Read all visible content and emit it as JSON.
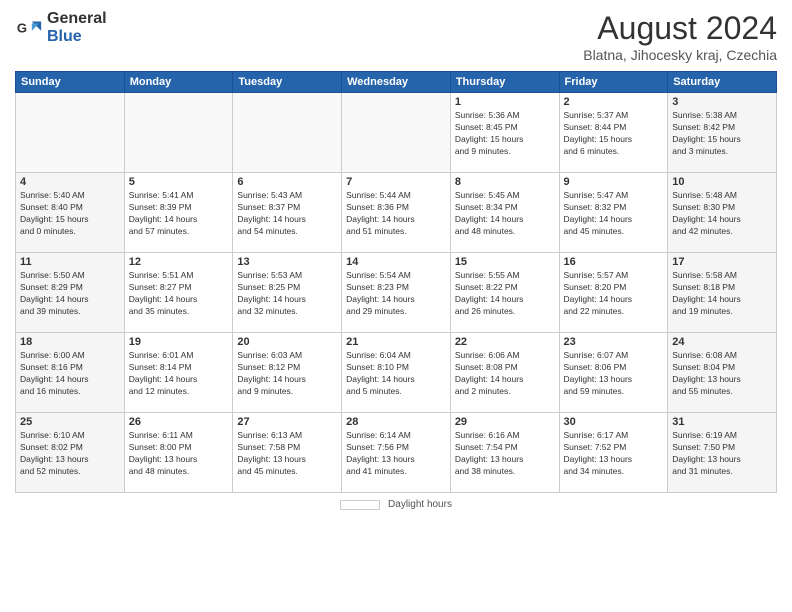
{
  "header": {
    "logo_general": "General",
    "logo_blue": "Blue",
    "main_title": "August 2024",
    "subtitle": "Blatna, Jihocesky kraj, Czechia"
  },
  "calendar": {
    "days_of_week": [
      "Sunday",
      "Monday",
      "Tuesday",
      "Wednesday",
      "Thursday",
      "Friday",
      "Saturday"
    ],
    "weeks": [
      [
        {
          "day": "",
          "info": ""
        },
        {
          "day": "",
          "info": ""
        },
        {
          "day": "",
          "info": ""
        },
        {
          "day": "",
          "info": ""
        },
        {
          "day": "1",
          "info": "Sunrise: 5:36 AM\nSunset: 8:45 PM\nDaylight: 15 hours\nand 9 minutes."
        },
        {
          "day": "2",
          "info": "Sunrise: 5:37 AM\nSunset: 8:44 PM\nDaylight: 15 hours\nand 6 minutes."
        },
        {
          "day": "3",
          "info": "Sunrise: 5:38 AM\nSunset: 8:42 PM\nDaylight: 15 hours\nand 3 minutes."
        }
      ],
      [
        {
          "day": "4",
          "info": "Sunrise: 5:40 AM\nSunset: 8:40 PM\nDaylight: 15 hours\nand 0 minutes."
        },
        {
          "day": "5",
          "info": "Sunrise: 5:41 AM\nSunset: 8:39 PM\nDaylight: 14 hours\nand 57 minutes."
        },
        {
          "day": "6",
          "info": "Sunrise: 5:43 AM\nSunset: 8:37 PM\nDaylight: 14 hours\nand 54 minutes."
        },
        {
          "day": "7",
          "info": "Sunrise: 5:44 AM\nSunset: 8:36 PM\nDaylight: 14 hours\nand 51 minutes."
        },
        {
          "day": "8",
          "info": "Sunrise: 5:45 AM\nSunset: 8:34 PM\nDaylight: 14 hours\nand 48 minutes."
        },
        {
          "day": "9",
          "info": "Sunrise: 5:47 AM\nSunset: 8:32 PM\nDaylight: 14 hours\nand 45 minutes."
        },
        {
          "day": "10",
          "info": "Sunrise: 5:48 AM\nSunset: 8:30 PM\nDaylight: 14 hours\nand 42 minutes."
        }
      ],
      [
        {
          "day": "11",
          "info": "Sunrise: 5:50 AM\nSunset: 8:29 PM\nDaylight: 14 hours\nand 39 minutes."
        },
        {
          "day": "12",
          "info": "Sunrise: 5:51 AM\nSunset: 8:27 PM\nDaylight: 14 hours\nand 35 minutes."
        },
        {
          "day": "13",
          "info": "Sunrise: 5:53 AM\nSunset: 8:25 PM\nDaylight: 14 hours\nand 32 minutes."
        },
        {
          "day": "14",
          "info": "Sunrise: 5:54 AM\nSunset: 8:23 PM\nDaylight: 14 hours\nand 29 minutes."
        },
        {
          "day": "15",
          "info": "Sunrise: 5:55 AM\nSunset: 8:22 PM\nDaylight: 14 hours\nand 26 minutes."
        },
        {
          "day": "16",
          "info": "Sunrise: 5:57 AM\nSunset: 8:20 PM\nDaylight: 14 hours\nand 22 minutes."
        },
        {
          "day": "17",
          "info": "Sunrise: 5:58 AM\nSunset: 8:18 PM\nDaylight: 14 hours\nand 19 minutes."
        }
      ],
      [
        {
          "day": "18",
          "info": "Sunrise: 6:00 AM\nSunset: 8:16 PM\nDaylight: 14 hours\nand 16 minutes."
        },
        {
          "day": "19",
          "info": "Sunrise: 6:01 AM\nSunset: 8:14 PM\nDaylight: 14 hours\nand 12 minutes."
        },
        {
          "day": "20",
          "info": "Sunrise: 6:03 AM\nSunset: 8:12 PM\nDaylight: 14 hours\nand 9 minutes."
        },
        {
          "day": "21",
          "info": "Sunrise: 6:04 AM\nSunset: 8:10 PM\nDaylight: 14 hours\nand 5 minutes."
        },
        {
          "day": "22",
          "info": "Sunrise: 6:06 AM\nSunset: 8:08 PM\nDaylight: 14 hours\nand 2 minutes."
        },
        {
          "day": "23",
          "info": "Sunrise: 6:07 AM\nSunset: 8:06 PM\nDaylight: 13 hours\nand 59 minutes."
        },
        {
          "day": "24",
          "info": "Sunrise: 6:08 AM\nSunset: 8:04 PM\nDaylight: 13 hours\nand 55 minutes."
        }
      ],
      [
        {
          "day": "25",
          "info": "Sunrise: 6:10 AM\nSunset: 8:02 PM\nDaylight: 13 hours\nand 52 minutes."
        },
        {
          "day": "26",
          "info": "Sunrise: 6:11 AM\nSunset: 8:00 PM\nDaylight: 13 hours\nand 48 minutes."
        },
        {
          "day": "27",
          "info": "Sunrise: 6:13 AM\nSunset: 7:58 PM\nDaylight: 13 hours\nand 45 minutes."
        },
        {
          "day": "28",
          "info": "Sunrise: 6:14 AM\nSunset: 7:56 PM\nDaylight: 13 hours\nand 41 minutes."
        },
        {
          "day": "29",
          "info": "Sunrise: 6:16 AM\nSunset: 7:54 PM\nDaylight: 13 hours\nand 38 minutes."
        },
        {
          "day": "30",
          "info": "Sunrise: 6:17 AM\nSunset: 7:52 PM\nDaylight: 13 hours\nand 34 minutes."
        },
        {
          "day": "31",
          "info": "Sunrise: 6:19 AM\nSunset: 7:50 PM\nDaylight: 13 hours\nand 31 minutes."
        }
      ]
    ]
  },
  "footer": {
    "daylight_hours_label": "Daylight hours"
  }
}
